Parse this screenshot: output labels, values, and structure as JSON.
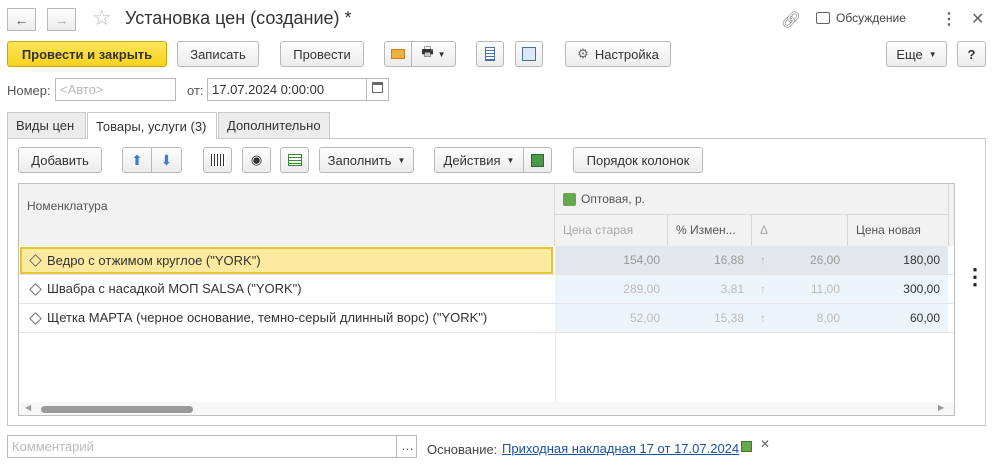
{
  "window": {
    "title": "Установка цен (создание) *",
    "discuss_label": "Обсуждение"
  },
  "toolbar": {
    "post_close": "Провести и закрыть",
    "write": "Записать",
    "post": "Провести",
    "settings": "Настройка",
    "more": "Еще",
    "help": "?"
  },
  "header": {
    "number_label": "Номер:",
    "number_placeholder": "<Авто>",
    "date_label": "от:",
    "date_value": "17.07.2024  0:00:00"
  },
  "tabs": [
    {
      "label": "Виды цен"
    },
    {
      "label": "Товары, услуги (3)"
    },
    {
      "label": "Дополнительно"
    }
  ],
  "table_toolbar": {
    "add": "Добавить",
    "fill": "Заполнить",
    "actions": "Действия",
    "column_order": "Порядок колонок"
  },
  "table": {
    "col_name": "Номенклатура",
    "group": "Оптовая, р.",
    "col_old": "Цена старая",
    "col_pct": "% Измен...",
    "col_delta": "Δ",
    "col_new": "Цена новая",
    "rows": [
      {
        "name": "Ведро с отжимом  круглое (\"YORK\")",
        "old": "154,00",
        "pct": "16,88",
        "delta": "26,00",
        "new": "180,00"
      },
      {
        "name": "Швабра с насадкой МОП SALSA (\"YORK\")",
        "old": "289,00",
        "pct": "3,81",
        "delta": "11,00",
        "new": "300,00"
      },
      {
        "name": "Щетка МАРТА (черное основание, темно-серый длинный ворс) (\"YORK\")",
        "old": "52,00",
        "pct": "15,38",
        "delta": "8,00",
        "new": "60,00"
      }
    ]
  },
  "footer": {
    "comment_placeholder": "Комментарий",
    "basis_label": "Основание:",
    "basis_link": "Приходная накладная 17 от 17.07.2024"
  },
  "colors": {
    "accent": "#f7d21b",
    "link": "#1a53a6",
    "selected_row": "#fbeaa0"
  }
}
